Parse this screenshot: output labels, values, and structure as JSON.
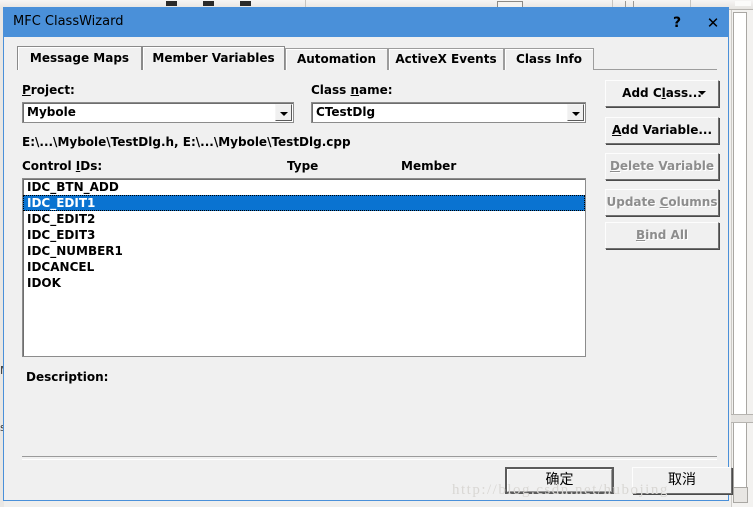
{
  "background": {
    "description": "ide-window-behind-dialog",
    "left_text_fragments": [
      "M",
      "s"
    ]
  },
  "dialog": {
    "title": "MFC ClassWizard",
    "help_button": "?",
    "close_button": "✕",
    "tabs": [
      {
        "label": "Message Maps",
        "active": false
      },
      {
        "label": "Member Variables",
        "active": true
      },
      {
        "label": "Automation",
        "active": false
      },
      {
        "label": "ActiveX Events",
        "active": false
      },
      {
        "label": "Class Info",
        "active": false
      }
    ],
    "project": {
      "label_prefix": "",
      "label": "Project:",
      "label_underline_char": "P",
      "value": "Mybole"
    },
    "class_name": {
      "label": "Class name:",
      "label_underline_char": "n",
      "value": "CTestDlg"
    },
    "file_path": "E:\\...\\Mybole\\TestDlg.h, E:\\...\\Mybole\\TestDlg.cpp",
    "columns": {
      "control_ids": "Control IDs:",
      "control_ids_underline_char": "D",
      "type": "Type",
      "member": "Member"
    },
    "control_ids": [
      {
        "id": "IDC_BTN_ADD",
        "type": "",
        "member": "",
        "selected": false
      },
      {
        "id": "IDC_EDIT1",
        "type": "",
        "member": "",
        "selected": true
      },
      {
        "id": "IDC_EDIT2",
        "type": "",
        "member": "",
        "selected": false
      },
      {
        "id": "IDC_EDIT3",
        "type": "",
        "member": "",
        "selected": false
      },
      {
        "id": "IDC_NUMBER1",
        "type": "",
        "member": "",
        "selected": false
      },
      {
        "id": "IDCANCEL",
        "type": "",
        "member": "",
        "selected": false
      },
      {
        "id": "IDOK",
        "type": "",
        "member": "",
        "selected": false
      }
    ],
    "side_buttons": [
      {
        "label": "Add Class...",
        "underline_char": "l",
        "enabled": true,
        "has_dropdown": true
      },
      {
        "label": "Add Variable...",
        "underline_char": "A",
        "enabled": true,
        "has_dropdown": false
      },
      {
        "label": "Delete Variable",
        "underline_char": "D",
        "enabled": false,
        "has_dropdown": false
      },
      {
        "label": "Update Columns",
        "underline_char": "C",
        "enabled": false,
        "has_dropdown": false
      },
      {
        "label": "Bind All",
        "underline_char": "B",
        "enabled": false,
        "has_dropdown": false
      }
    ],
    "description": {
      "label": "Description:",
      "text": ""
    },
    "ok_button": "确定",
    "cancel_button": "取消"
  },
  "watermark": "http://blog.csdn.net/hubojing",
  "colors": {
    "title_bar": "#4a90d9",
    "selection": "#0a73d1",
    "dialog_face": "#f0f0f0",
    "disabled_text": "#8d8d8d"
  }
}
